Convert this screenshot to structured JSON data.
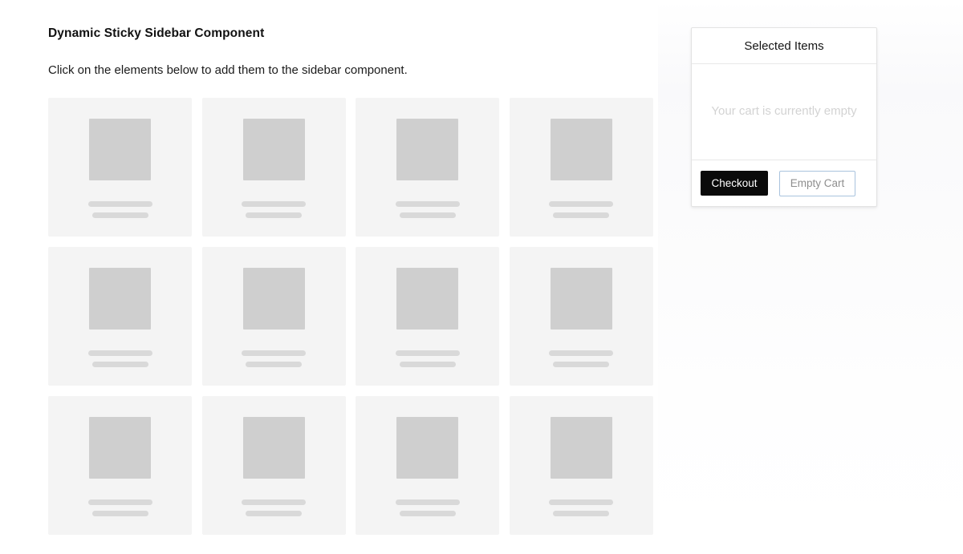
{
  "page": {
    "title": "Dynamic Sticky Sidebar Component",
    "subtitle": "Click on the elements below to add them to the sidebar component."
  },
  "grid": {
    "columns": 4,
    "rows": 3,
    "item_count": 12,
    "card_background": "#f4f4f4",
    "thumb_color": "#cfcfcf",
    "skeleton_color": "#d9d9d9",
    "items": [
      {
        "index": 1,
        "thumb": "image-placeholder",
        "line1": "",
        "line2": ""
      },
      {
        "index": 2,
        "thumb": "image-placeholder",
        "line1": "",
        "line2": ""
      },
      {
        "index": 3,
        "thumb": "image-placeholder",
        "line1": "",
        "line2": ""
      },
      {
        "index": 4,
        "thumb": "image-placeholder",
        "line1": "",
        "line2": ""
      },
      {
        "index": 5,
        "thumb": "image-placeholder",
        "line1": "",
        "line2": ""
      },
      {
        "index": 6,
        "thumb": "image-placeholder",
        "line1": "",
        "line2": ""
      },
      {
        "index": 7,
        "thumb": "image-placeholder",
        "line1": "",
        "line2": ""
      },
      {
        "index": 8,
        "thumb": "image-placeholder",
        "line1": "",
        "line2": ""
      },
      {
        "index": 9,
        "thumb": "image-placeholder",
        "line1": "",
        "line2": ""
      },
      {
        "index": 10,
        "thumb": "image-placeholder",
        "line1": "",
        "line2": ""
      },
      {
        "index": 11,
        "thumb": "image-placeholder",
        "line1": "",
        "line2": ""
      },
      {
        "index": 12,
        "thumb": "image-placeholder",
        "line1": "",
        "line2": ""
      }
    ]
  },
  "sidebar": {
    "header_title": "Selected Items",
    "empty_message": "Your cart is currently empty",
    "checkout_label": "Checkout",
    "empty_cart_label": "Empty Cart",
    "colors": {
      "checkout_background": "#0a0a0a",
      "checkout_text": "#ffffff",
      "empty_cart_border": "#a9c3de",
      "empty_cart_text": "#8e8e8e",
      "empty_message_text": "#d3d3d3",
      "card_border": "#e3e3e3"
    }
  }
}
